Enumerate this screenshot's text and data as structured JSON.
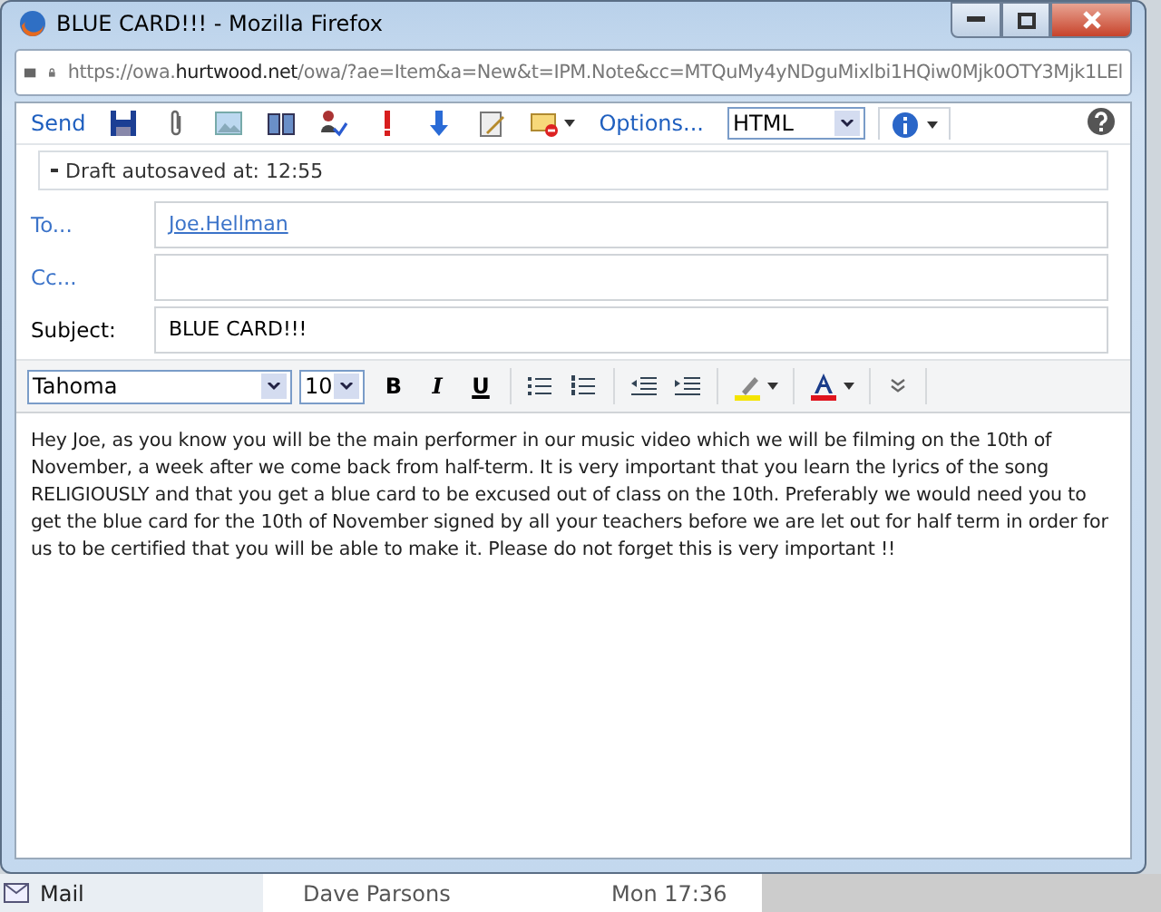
{
  "window": {
    "title": "BLUE CARD!!! - Mozilla Firefox"
  },
  "address_bar": {
    "url": "https://owa.**hurtwood.net**/owa/?ae=Item&a=New&t=IPM.Note&cc=MTQuMy4yNDguMixlbi1HQiw0Mjk0OTY3Mjk1LEl"
  },
  "toolbar": {
    "send": "Send",
    "options": "Options...",
    "format": "HTML"
  },
  "draft_notice": "Draft autosaved at: 12:55",
  "fields": [
    {
      "kind": "address",
      "label": "To...",
      "value": "Joe.Hellman"
    },
    {
      "kind": "address",
      "label": "Cc..."
    },
    {
      "kind": "text",
      "label": "Subject:",
      "value": "BLUE CARD!!!"
    }
  ],
  "format_bar": {
    "font": "Tahoma",
    "size": "10",
    "bold": "B",
    "italic": "I",
    "underline": "U"
  },
  "body": "Hey Joe, as you know you will be the main performer in our music video which we will be filming on the 10th of November, a week after we come back from half-term. It is very important that you learn the lyrics of the song RELIGIOUSLY and that you get a blue card to be excused out of class on the 10th. Preferably we would need you to get the blue card for the 10th of November signed by all your teachers before we are let out for half term in order for us to be certified that you will be able to make it. Please do not forget this is very important !!",
  "background": {
    "folder": "Mail",
    "sender": "Dave Parsons",
    "time": "Mon 17:36"
  }
}
